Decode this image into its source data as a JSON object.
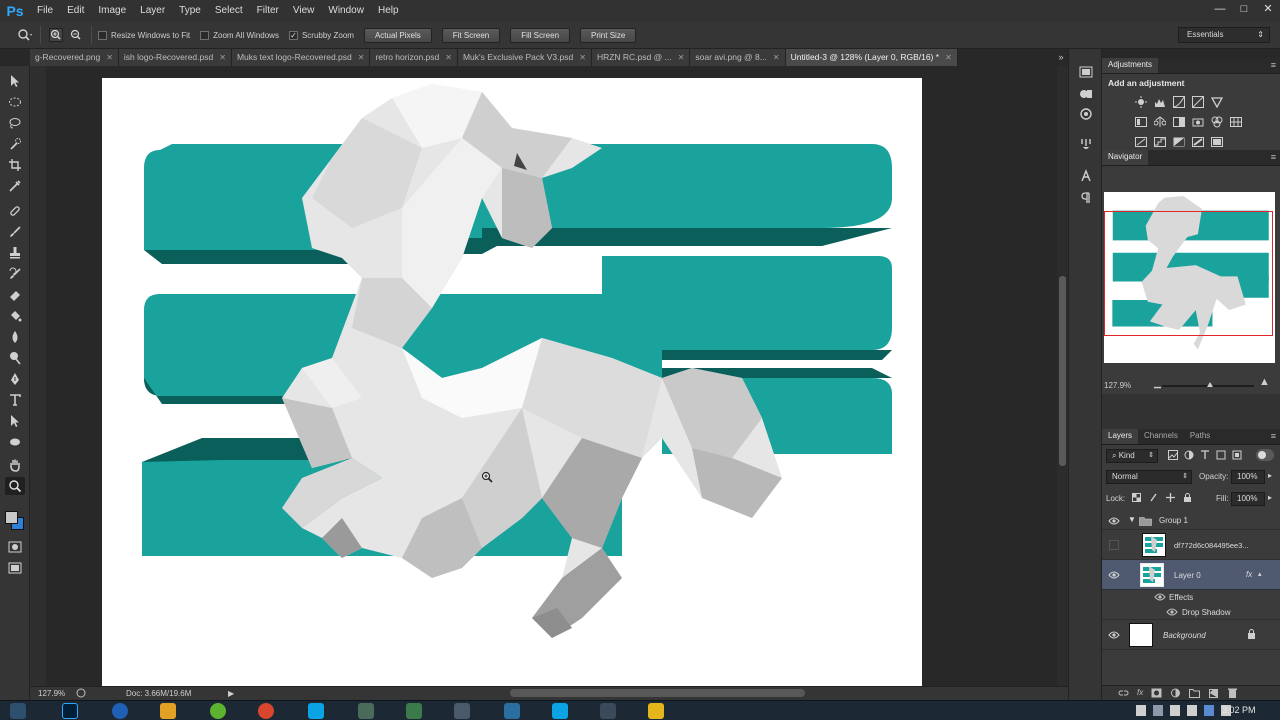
{
  "app": {
    "logo": "Ps"
  },
  "menu": [
    "File",
    "Edit",
    "Image",
    "Layer",
    "Type",
    "Select",
    "Filter",
    "View",
    "Window",
    "Help"
  ],
  "window_controls": {
    "minimize": "—",
    "restore": "□",
    "close": "✕"
  },
  "options_bar": {
    "resize_windows": "Resize Windows to Fit",
    "zoom_all": "Zoom All Windows",
    "scrubby_zoom": "Scrubby Zoom",
    "actual_pixels": "Actual Pixels",
    "fit_screen": "Fit Screen",
    "fill_screen": "Fill Screen",
    "print_size": "Print Size",
    "workspace": "Essentials"
  },
  "tabs": [
    {
      "label": "g-Recovered.png",
      "active": false
    },
    {
      "label": "ish logo-Recovered.psd",
      "active": false
    },
    {
      "label": "Muks text logo-Recovered.psd",
      "active": false
    },
    {
      "label": "retro horizon.psd",
      "active": false
    },
    {
      "label": "Muk's Exclusive Pack V3.psd",
      "active": false
    },
    {
      "label": "HRZN RC.psd @ ...",
      "active": false
    },
    {
      "label": "soar avi.png @ 8...",
      "active": false
    },
    {
      "label": "Untitled-3 @ 128% (Layer 0, RGB/16) *",
      "active": true
    }
  ],
  "tabs_overflow": "»",
  "tools": [
    "move-tool",
    "marquee-tool",
    "lasso-tool",
    "quick-select-tool",
    "crop-tool",
    "eyedropper-tool",
    "healing-tool",
    "brush-tool",
    "stamp-tool",
    "history-brush-tool",
    "eraser-tool",
    "gradient-tool",
    "blur-tool",
    "dodge-tool",
    "pen-tool",
    "type-tool",
    "path-select-tool",
    "shape-tool",
    "hand-tool",
    "zoom-tool"
  ],
  "status": {
    "zoom": "127.9%",
    "doc": "Doc: 3.66M/19.6M"
  },
  "colors": {
    "teal": "#1aa29c",
    "teal_dark": "#0b5f5b",
    "foreground": "#c8c8c8",
    "background": "#2d7fd8",
    "accent_red": "#e0262b",
    "selected_layer": "#4f5a70"
  },
  "adjustments": {
    "tab": "Adjustments",
    "title": "Add an adjustment"
  },
  "navigator": {
    "tab": "Navigator",
    "zoom": "127.9%"
  },
  "layers_panel": {
    "tabs": [
      "Layers",
      "Channels",
      "Paths"
    ],
    "filter": "Kind",
    "blend_mode": "Normal",
    "opacity_label": "Opacity:",
    "opacity": "100%",
    "lock_label": "Lock:",
    "fill_label": "Fill:",
    "fill": "100%",
    "layers": [
      {
        "name": "Group 1"
      },
      {
        "name": "df772d6c084495ee3..."
      },
      {
        "name": "Layer 0",
        "fx": "fx"
      },
      {
        "name": "Effects"
      },
      {
        "name": "Drop Shadow"
      },
      {
        "name": "Background"
      }
    ]
  },
  "taskbar": {
    "clock": "3:02 PM"
  }
}
